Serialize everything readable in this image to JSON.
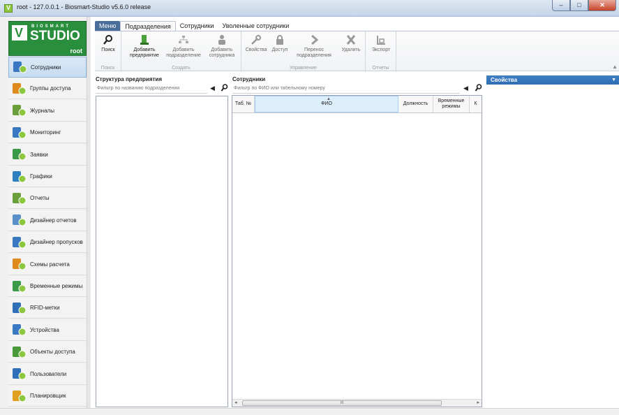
{
  "window": {
    "title": "root - 127.0.0.1 - Biosmart-Studio v5.6.0 release",
    "controls": [
      "–",
      "□",
      "✕"
    ]
  },
  "logo": {
    "brand": "BIOSMART",
    "product": "STUDIO",
    "user": "root"
  },
  "sidebar": {
    "items": [
      {
        "label": "Сотрудники",
        "icon": "employees-icon",
        "active": true
      },
      {
        "label": "Группы доступа",
        "icon": "access-groups-icon"
      },
      {
        "label": "Журналы",
        "icon": "journals-icon"
      },
      {
        "label": "Мониторинг",
        "icon": "monitoring-icon"
      },
      {
        "label": "Заявки",
        "icon": "requests-icon"
      },
      {
        "label": "Графики",
        "icon": "charts-icon"
      },
      {
        "label": "Отчеты",
        "icon": "reports-icon"
      },
      {
        "label": "Дизайнер отчетов",
        "icon": "report-designer-icon"
      },
      {
        "label": "Дизайнер пропусков",
        "icon": "pass-designer-icon"
      },
      {
        "label": "Схемы расчета",
        "icon": "calculation-schemes-icon"
      },
      {
        "label": "Временные режимы",
        "icon": "time-modes-icon"
      },
      {
        "label": "RFID-метки",
        "icon": "rfid-tags-icon"
      },
      {
        "label": "Устройства",
        "icon": "devices-icon"
      },
      {
        "label": "Объекты доступа",
        "icon": "access-objects-icon"
      },
      {
        "label": "Пользователи",
        "icon": "users-icon"
      },
      {
        "label": "Планировщик",
        "icon": "scheduler-icon"
      }
    ]
  },
  "ribbon": {
    "tabs": [
      "Меню",
      "Подразделения",
      "Сотрудники",
      "Уволенные сотрудники"
    ],
    "active_tab": "Подразделения",
    "groups": {
      "search": {
        "label": "Поиск",
        "button": "Поиск"
      },
      "create": {
        "label": "Создать",
        "add_enterprise": "Добавить предприятие",
        "add_department": "Добавить подразделение",
        "add_employee": "Добавить сотрудника"
      },
      "manage": {
        "label": "Управление",
        "properties": "Свойства",
        "access": "Доступ",
        "move_department": "Перенос подразделения",
        "delete": "Удалить"
      },
      "reports": {
        "label": "Отчеты",
        "export": "Экспорт"
      }
    }
  },
  "structure_panel": {
    "title": "Структура предприятия",
    "filter_placeholder": "Фильтр по названию подразделения"
  },
  "employees_panel": {
    "title": "Сотрудники",
    "filter_placeholder": "Фильтр по ФИО или табельному номеру",
    "columns": [
      "Таб. №",
      "ФИО",
      "Должность",
      "Временные режимы",
      "К"
    ],
    "scroll_thumb": "III"
  },
  "properties_panel": {
    "title": "Свойства"
  },
  "colors": {
    "accent": "#2f6db3",
    "logo_green": "#2a8f3d",
    "menu_tab": "#4a6d9a"
  }
}
